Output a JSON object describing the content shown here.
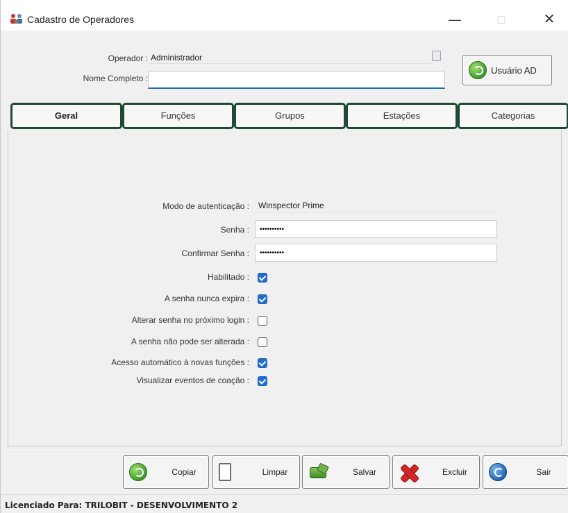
{
  "window": {
    "title": "Cadastro de Operadores",
    "controls": {
      "minimize": "—",
      "maximize": "□",
      "close": "✕"
    }
  },
  "header": {
    "operador_label": "Operador :",
    "operador_value": "Administrador",
    "nome_label": "Nome Completo :",
    "nome_value": "",
    "usuario_ad_label": "Usuário AD"
  },
  "tabs": [
    {
      "label": "Geral",
      "active": true
    },
    {
      "label": "Funções",
      "active": false
    },
    {
      "label": "Grupos",
      "active": false
    },
    {
      "label": "Estações",
      "active": false
    },
    {
      "label": "Categorias",
      "active": false
    }
  ],
  "form": {
    "modo_label": "Modo de autenticação :",
    "modo_value": "Winspector Prime",
    "senha_label": "Senha :",
    "senha_value": "••••••••••",
    "confirmar_label": "Confirmar Senha :",
    "confirmar_value": "••••••••••",
    "checkboxes": [
      {
        "label": "Habilitado :",
        "checked": true
      },
      {
        "label": "A senha nunca expira :",
        "checked": true
      },
      {
        "label": "Alterar senha no próximo login :",
        "checked": false
      },
      {
        "label": "A senha não pode ser alterada :",
        "checked": false
      },
      {
        "label": "Acesso automático à novas funções :",
        "checked": true
      },
      {
        "label": "Visualizar eventos de coação :",
        "checked": true
      }
    ]
  },
  "toolbar": {
    "copiar": "Copiar",
    "limpar": "Limpar",
    "salvar": "Salvar",
    "excluir": "Excluir",
    "sair": "Sair"
  },
  "status": {
    "text": "Licenciado Para: TRILOBIT - DESENVOLVIMENTO 2"
  },
  "colors": {
    "tab_border": "#1f4a31",
    "checkbox_checked": "#1e6fd0",
    "input_focus_underline": "#1d6fb8"
  }
}
